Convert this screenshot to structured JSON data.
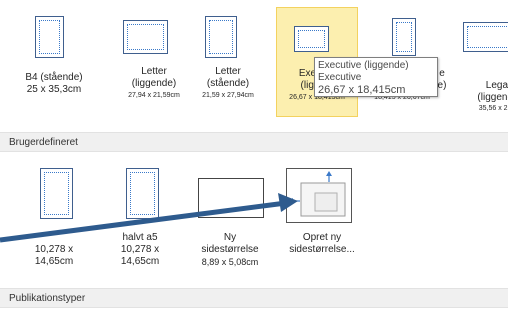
{
  "top_sizes": [
    {
      "name": "B4 (stående)",
      "dims": "25 x 35,3cm"
    },
    {
      "name": "Letter (liggende)",
      "name_l1": "Letter",
      "name_l2": "(liggende)",
      "dims": "27,94 x 21,59cm"
    },
    {
      "name": "Letter (stående)",
      "name_l1": "Letter",
      "name_l2": "(stående)",
      "dims": "21,59 x 27,94cm"
    },
    {
      "name_l1": "Exec",
      "name_l2": "(ligg",
      "dims": "26,67 x 18,415cm"
    },
    {
      "name_l1": "e",
      "name_l2": "e)",
      "dims": "18,415 x 26,67cm"
    },
    {
      "name_l1": "Legal",
      "name_l2": "(liggende",
      "dims": "35,56 x 21,5"
    }
  ],
  "tooltip": {
    "line1": "Executive (liggende)",
    "line2": "Executive",
    "line3": "26,67 x 18,415cm"
  },
  "sections": {
    "custom": "Brugerdefineret",
    "publication_types": "Publikationstyper"
  },
  "custom_sizes": [
    {
      "name": "",
      "dims_l1": "10,278 x",
      "dims_l2": "14,65cm"
    },
    {
      "name": "halvt a5",
      "dims_l1": "10,278 x",
      "dims_l2": "14,65cm"
    },
    {
      "name_l1": "Ny",
      "name_l2": "sidestørrelse",
      "dims": "8,89 x 5,08cm"
    },
    {
      "name_l1": "Opret ny",
      "name_l2": "sidestørrelse..."
    }
  ],
  "colors": {
    "selected_bg": "#fcefaf",
    "arrow": "#2e5b8e",
    "accent": "#3a79c9"
  }
}
